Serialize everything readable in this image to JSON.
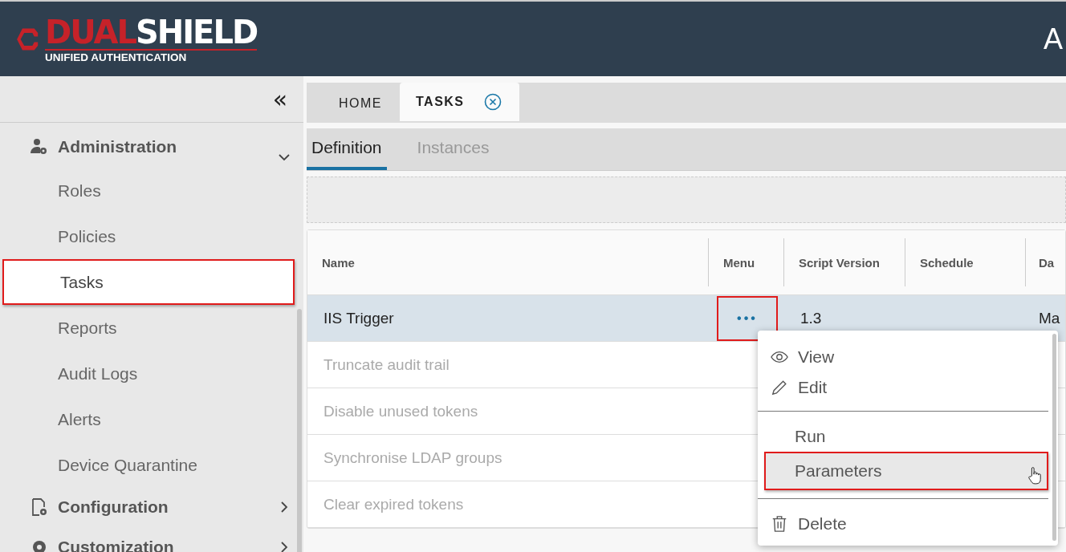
{
  "header": {
    "logo": {
      "brand_first": "DUAL",
      "brand_second": "SHIELD",
      "tagline": "UNIFIED AUTHENTICATION"
    },
    "title": "A"
  },
  "sidebar": {
    "collapse": "«",
    "groups": [
      {
        "label": "Administration",
        "expanded": true,
        "children": [
          {
            "label": "Roles",
            "selected": false,
            "highlighted": false
          },
          {
            "label": "Policies",
            "selected": false,
            "highlighted": false
          },
          {
            "label": "Tasks",
            "selected": true,
            "highlighted": true
          },
          {
            "label": "Reports",
            "selected": false,
            "highlighted": false
          },
          {
            "label": "Audit Logs",
            "selected": false,
            "highlighted": false
          },
          {
            "label": "Alerts",
            "selected": false,
            "highlighted": false
          },
          {
            "label": "Device Quarantine",
            "selected": false,
            "highlighted": false
          }
        ]
      },
      {
        "label": "Configuration",
        "expanded": false
      },
      {
        "label": "Customization",
        "expanded": false
      }
    ]
  },
  "tabs": [
    {
      "label": "HOME",
      "selected": false,
      "closable": false
    },
    {
      "label": "TASKS",
      "selected": true,
      "closable": true
    }
  ],
  "subtabs": [
    {
      "label": "Definition",
      "selected": true
    },
    {
      "label": "Instances",
      "selected": false
    }
  ],
  "table": {
    "columns": [
      "Name",
      "Menu",
      "Script Version",
      "Schedule",
      "Da"
    ],
    "rows": [
      {
        "name": "IIS Trigger",
        "menu": "•••",
        "version": "1.3",
        "column_5": "Ma",
        "selected": true,
        "highlighted": true
      },
      {
        "name": "Truncate audit trail",
        "selected": false
      },
      {
        "name": "Disable unused tokens",
        "selected": false
      },
      {
        "name": "Synchronise LDAP groups",
        "selected": false
      },
      {
        "name": "Clear expired tokens",
        "selected": false
      }
    ]
  },
  "context_menu": {
    "items": [
      {
        "kind": "item",
        "label": "View",
        "highlighted": false
      },
      {
        "kind": "item",
        "label": "Edit",
        "highlighted": false
      },
      {
        "kind": "divider"
      },
      {
        "kind": "item",
        "label": "Run",
        "highlighted": false
      },
      {
        "kind": "item",
        "label": "Parameters",
        "highlighted": true
      },
      {
        "kind": "divider"
      },
      {
        "kind": "item",
        "label": "Delete",
        "highlighted": false
      }
    ]
  }
}
